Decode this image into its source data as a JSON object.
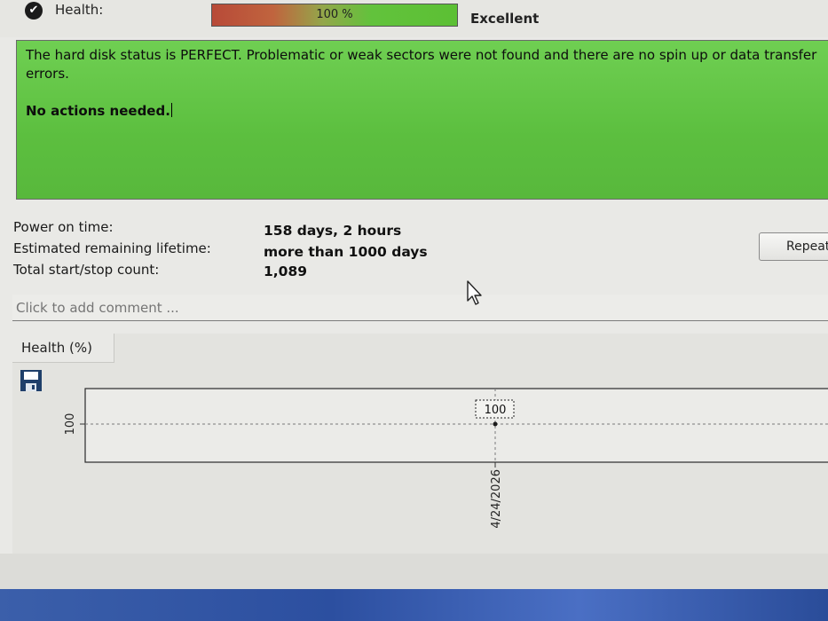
{
  "health": {
    "label": "Health:",
    "percent": 100,
    "percent_text": "100 %",
    "status": "Excellent",
    "icon": "check-circle-icon"
  },
  "status_box": {
    "message": "The hard disk status is PERFECT. Problematic or weak sectors were not found and there are no spin up or data transfer errors.",
    "action": "No actions needed.",
    "color": "#5cbf3f"
  },
  "info": [
    {
      "label": "Power on time:",
      "value": "158 days, 2 hours"
    },
    {
      "label": "Estimated remaining lifetime:",
      "value": "more than 1000 days"
    },
    {
      "label": "Total start/stop count:",
      "value": "1,089"
    }
  ],
  "repeat_button": {
    "label": "Repeat"
  },
  "comment": {
    "placeholder": "Click to add comment ..."
  },
  "chart_tab": {
    "label": "Health (%)"
  },
  "save_icon": "save-icon",
  "chart_data": {
    "type": "line",
    "x": [
      "4/24/2026"
    ],
    "series": [
      {
        "values": [
          100
        ]
      }
    ],
    "data_labels": [
      "100"
    ],
    "ytick_labels": [
      "100"
    ],
    "xtick_labels": [
      "4/24/2026"
    ],
    "grid": true
  }
}
